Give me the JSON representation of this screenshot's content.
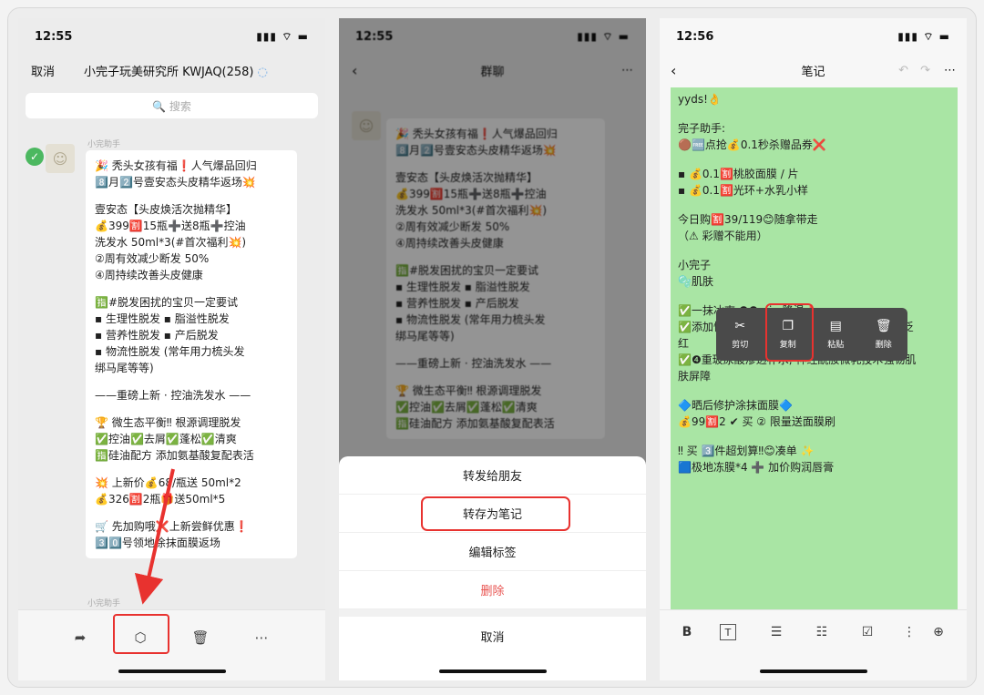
{
  "panel1": {
    "time": "12:55",
    "signal": "▮▮▮ ⌔ ▬",
    "cancel": "取消",
    "group_title": "小完子玩美研究所 KWJAQ(258)",
    "search_placeholder": "🔍 搜索",
    "sender1": "小完助手",
    "sender2": "小完助手",
    "message_lines": [
      "🎉 秃头女孩有福❗人气爆品回归",
      "8️⃣月2️⃣号壹安态头皮精华返场💥",
      "",
      "壹安态【头皮焕活次抛精华】",
      "💰399🈹15瓶➕送8瓶➕控油",
      "洗发水 50ml*3(#首次福利💥)",
      "②周有效减少断发 50%",
      "④周持续改善头皮健康",
      "",
      "🈯#脱发困扰的宝贝一定要试",
      "▪ 生理性脱发 ▪ 脂溢性脱发",
      "▪ 营养性脱发 ▪ 产后脱发",
      "▪ 物流性脱发 (常年用力梳头发",
      "绑马尾等等)",
      "",
      "——重磅上新 · 控油洗发水 ——",
      "",
      "🏆 微生态平衡‼ 根源调理脱发",
      "✅控油✅去屑✅蓬松✅清爽",
      "🈯硅油配方 添加氨基酸复配表活",
      "",
      "💥 上新价💰68/瓶送 50ml*2",
      "💰326🈹2瓶🎁送50ml*5",
      "",
      "🛒 先加购哦❌上新尝鲜优惠❗",
      "3️⃣0️⃣号领地涂抹面膜返场"
    ]
  },
  "panel2": {
    "time": "12:55",
    "title": "群聊",
    "sheet_options": [
      "转发给朋友",
      "转存为笔记",
      "编辑标签",
      "删除"
    ],
    "cancel": "取消",
    "bg_lines": [
      "🎉 秃头女孩有福❗人气爆品回归",
      "8️⃣月2️⃣号壹安态头皮精华返场💥",
      "",
      "壹安态【头皮焕活次抛精华】",
      "💰399🈹15瓶➕送8瓶➕控油",
      "洗发水 50ml*3(#首次福利💥)",
      "②周有效减少断发 50%",
      "④周持续改善头皮健康",
      "",
      "🈯#脱发困扰的宝贝一定要试",
      "▪ 生理性脱发 ▪ 脂溢性脱发",
      "▪ 营养性脱发 ▪ 产后脱发",
      "▪ 物流性脱发 (常年用力梳头发",
      "绑马尾等等)",
      "",
      "——重磅上新 · 控油洗发水 ——",
      "",
      "🏆 微生态平衡‼ 根源调理脱发",
      "✅控油✅去屑✅蓬松✅清爽",
      "🈯硅油配方 添加氨基酸复配表活"
    ]
  },
  "panel3": {
    "time": "12:56",
    "title": "笔记",
    "note_lines": [
      "yyds!👌",
      "",
      "完子助手:",
      "🟤🆓点抢💰0.1秒杀赠品券❌",
      "",
      "▪ 💰0.1🈹桃胶面膜 / 片",
      "▪ 💰0.1🈹光环+水乳小样",
      "",
      "今日购🈹39/119😊随拿带走",
      "（⚠ 彩赠不能用）",
      "",
      "小完子",
      "🫧肌肤",
      "",
      "✅一抹冰爽 ❶❺min 降温❗",
      "✅添加悦肤宁+静勒舒+因敏生, 快速舒缓晒后泛",
      "红",
      "✅❹重玻尿酸渗透补水, 神经酰胺微乳技术强韧肌",
      "肤屏障",
      "",
      "🔷晒后修护涂抹面膜🔷",
      "💰99🈹2 ✔ 买 ② 限量送面膜刷",
      "",
      "‼ 买 3️⃣件超划算‼😊凑单 ✨",
      "🟦极地冻膜*4 ➕ 加价购润唇膏"
    ],
    "context_menu": [
      {
        "icon": "✂",
        "label": "剪切"
      },
      {
        "icon": "❐",
        "label": "复制"
      },
      {
        "icon": "▤",
        "label": "粘贴"
      },
      {
        "icon": "🗑",
        "label": "删除"
      }
    ],
    "format_icons": [
      "B",
      "T",
      "☰",
      "☷",
      "☑",
      "⋮",
      "⊕"
    ]
  }
}
